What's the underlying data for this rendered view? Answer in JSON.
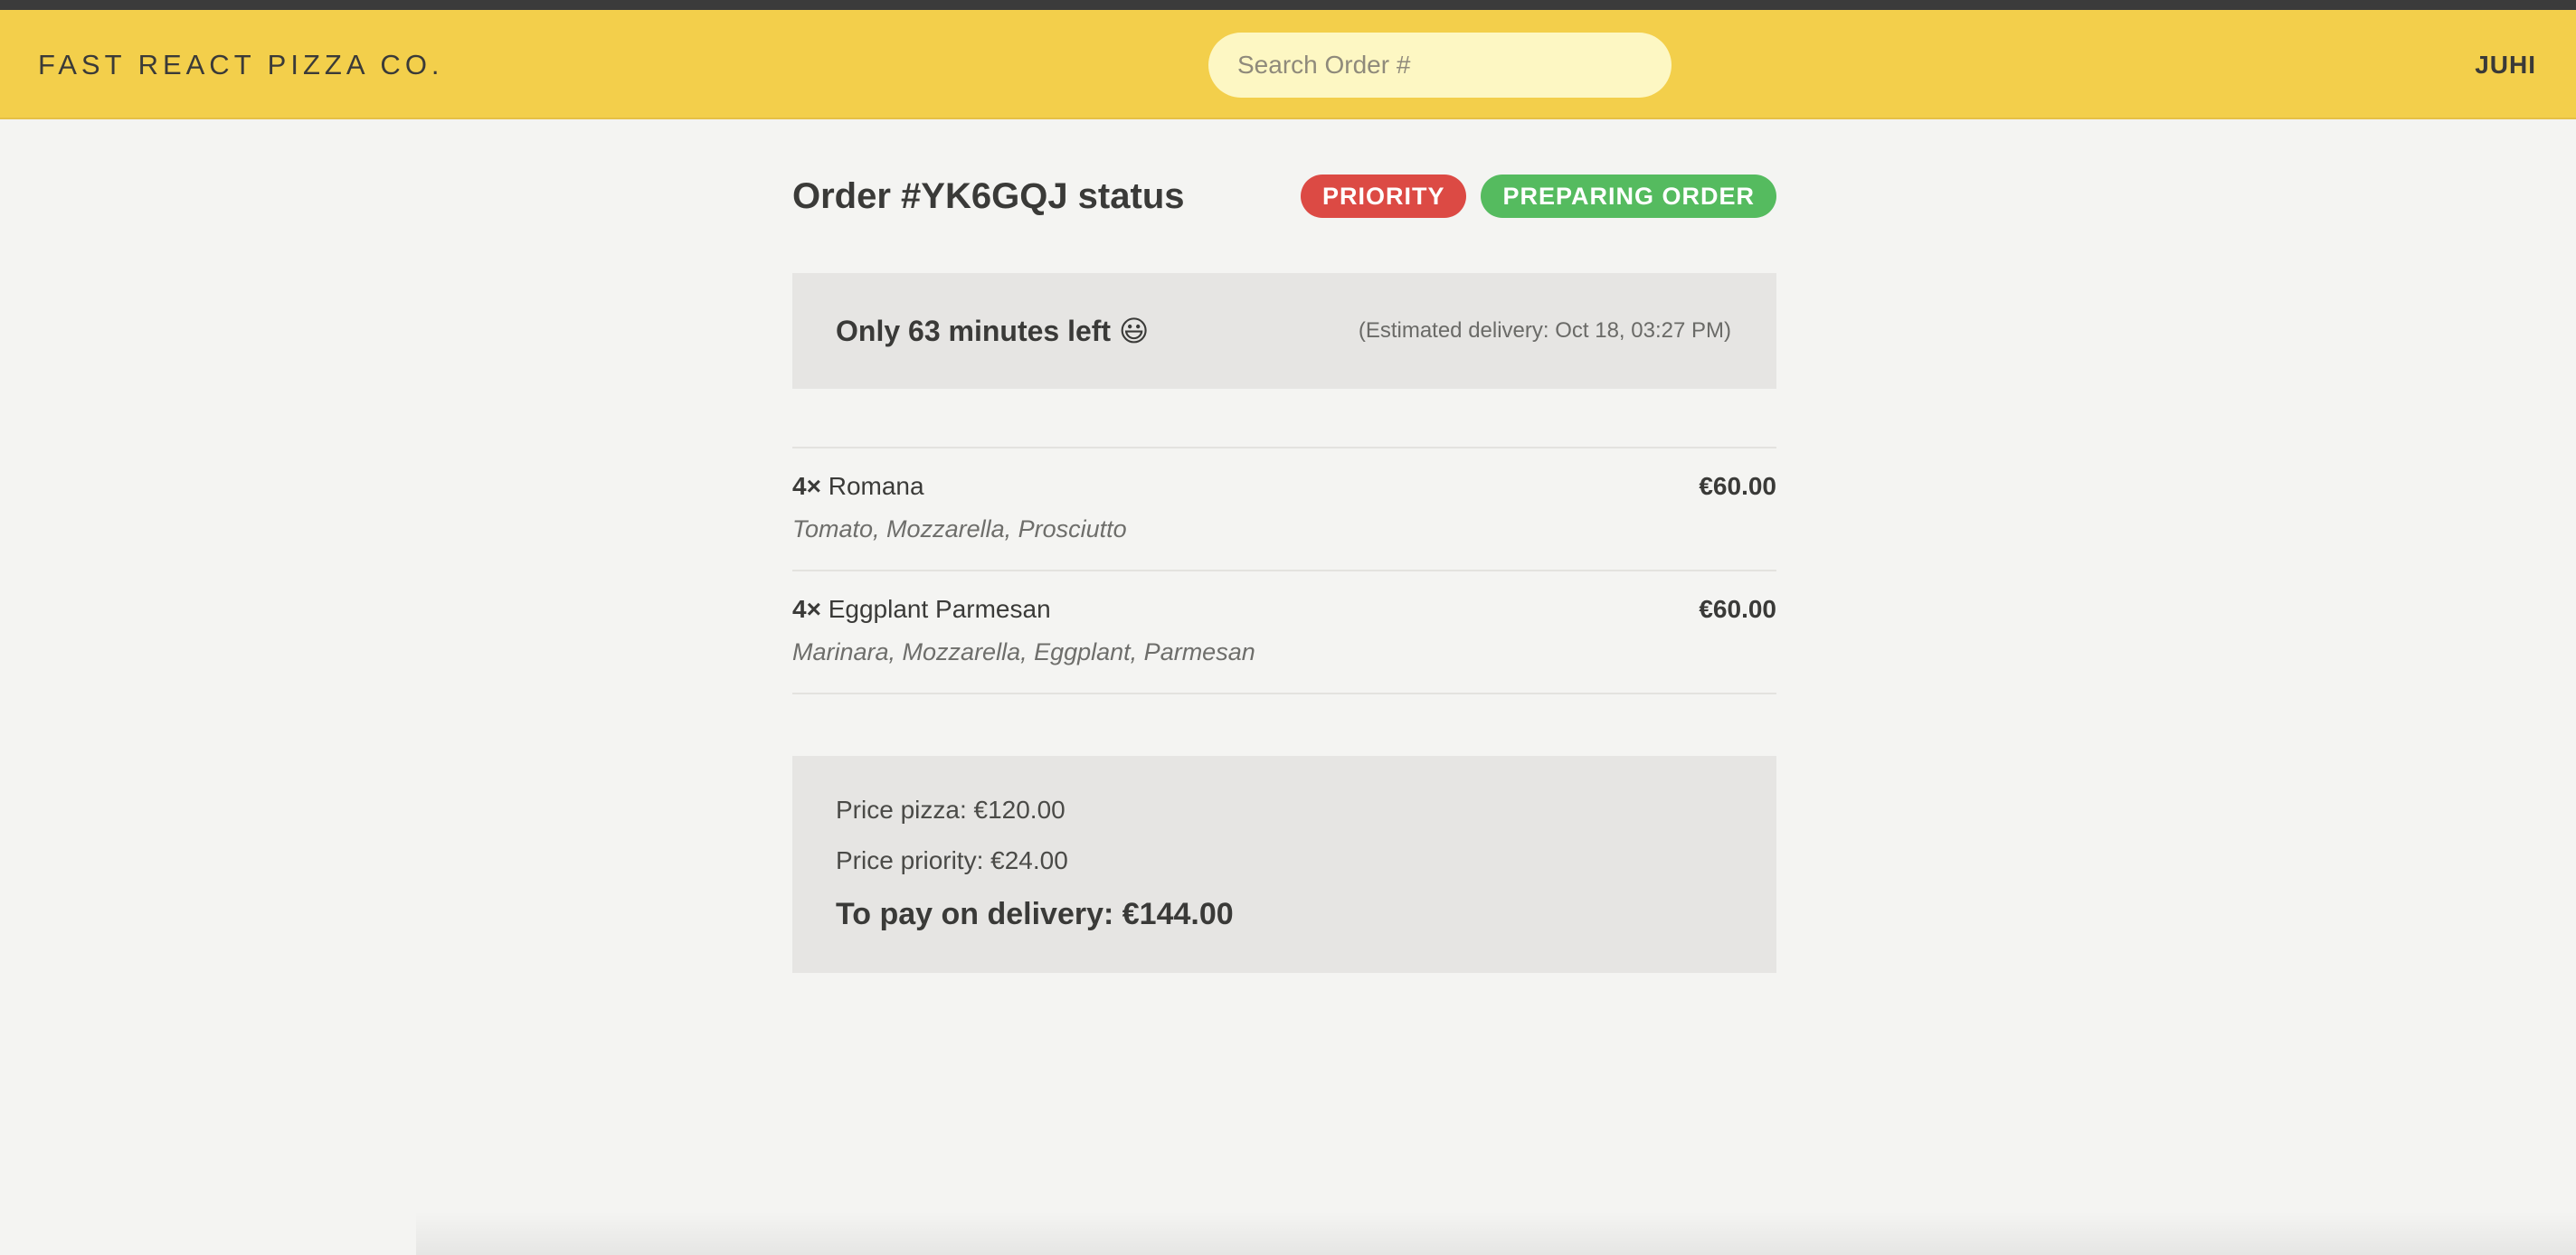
{
  "header": {
    "logo": "FAST REACT PIZZA CO.",
    "search_placeholder": "Search Order #",
    "search_value": "",
    "username": "JUHI"
  },
  "order": {
    "title": "Order #YK6GQJ status",
    "badges": {
      "priority": "PRIORITY",
      "status": "PREPARING ORDER"
    },
    "eta": {
      "remaining": "Only 63 minutes left 😃",
      "estimated": "(Estimated delivery: Oct 18, 03:27 PM)"
    },
    "items": [
      {
        "qty": "4×",
        "name": "Romana",
        "price": "€60.00",
        "ingredients": "Tomato, Mozzarella, Prosciutto"
      },
      {
        "qty": "4×",
        "name": "Eggplant Parmesan",
        "price": "€60.00",
        "ingredients": "Marinara, Mozzarella, Eggplant, Parmesan"
      }
    ],
    "summary": {
      "price_pizza": "Price pizza: €120.00",
      "price_priority": "Price priority: €24.00",
      "to_pay": "To pay on delivery: €144.00"
    }
  },
  "colors": {
    "header_bg": "#f3cf4b",
    "search_bg": "#fdf7c3",
    "priority_badge": "#dc4a44",
    "status_badge": "#55bb5f",
    "panel_bg": "#e6e5e3",
    "page_bg": "#f4f4f2"
  }
}
